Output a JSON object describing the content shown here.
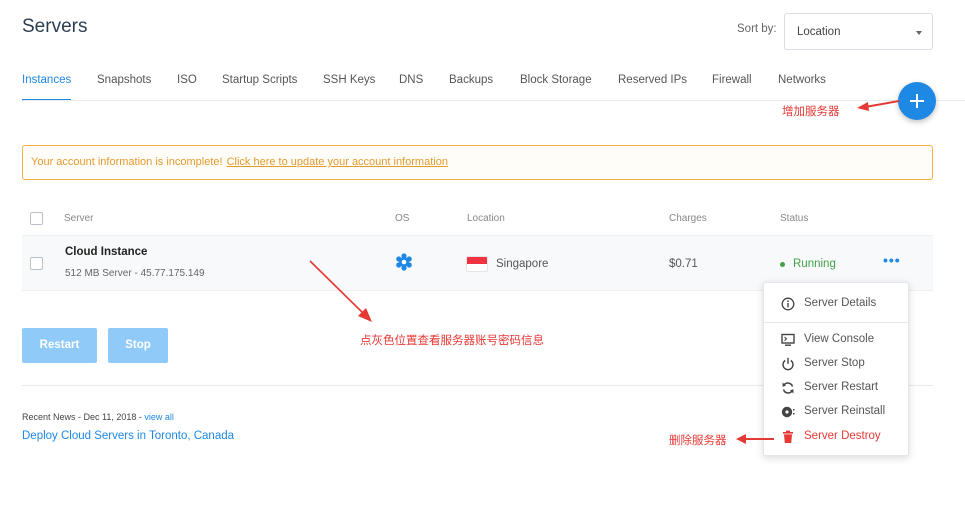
{
  "header": {
    "title": "Servers",
    "sort_label": "Sort by:",
    "sort_value": "Location"
  },
  "tabs": [
    {
      "label": "Instances",
      "active": true
    },
    {
      "label": "Snapshots"
    },
    {
      "label": "ISO"
    },
    {
      "label": "Startup Scripts"
    },
    {
      "label": "SSH Keys"
    },
    {
      "label": "DNS"
    },
    {
      "label": "Backups"
    },
    {
      "label": "Block Storage"
    },
    {
      "label": "Reserved IPs"
    },
    {
      "label": "Firewall"
    },
    {
      "label": "Networks"
    }
  ],
  "alert": {
    "text": "Your account information is incomplete!",
    "link": "Click here to update your account information"
  },
  "table": {
    "headers": {
      "server": "Server",
      "os": "OS",
      "location": "Location",
      "charges": "Charges",
      "status": "Status"
    },
    "row": {
      "name": "Cloud Instance",
      "sub": "512 MB Server - 45.77.175.149",
      "location": "Singapore",
      "charges": "$0.71",
      "status": "Running",
      "more": "•••"
    }
  },
  "buttons": {
    "restart": "Restart",
    "stop": "Stop"
  },
  "news": {
    "meta": "Recent News - Dec 11, 2018 - ",
    "view_all": "view all",
    "title": "Deploy Cloud Servers in Toronto, Canada"
  },
  "menu": {
    "items": [
      {
        "label": "Server Details",
        "icon": "info-icon"
      },
      {
        "label": "View Console",
        "icon": "monitor-icon"
      },
      {
        "label": "Server Stop",
        "icon": "power-icon"
      },
      {
        "label": "Server Restart",
        "icon": "restart-icon"
      },
      {
        "label": "Server Reinstall",
        "icon": "disc-icon"
      },
      {
        "label": "Server Destroy",
        "icon": "trash-icon",
        "danger": true
      }
    ]
  },
  "annotations": {
    "add_server": "增加服务器",
    "click_gray": "点灰色位置查看服务器账号密码信息",
    "delete_server": "删除服务器"
  },
  "colors": {
    "accent": "#1e88e5",
    "running": "#43a047",
    "danger": "#e53935",
    "alert_border": "#f5b041"
  }
}
